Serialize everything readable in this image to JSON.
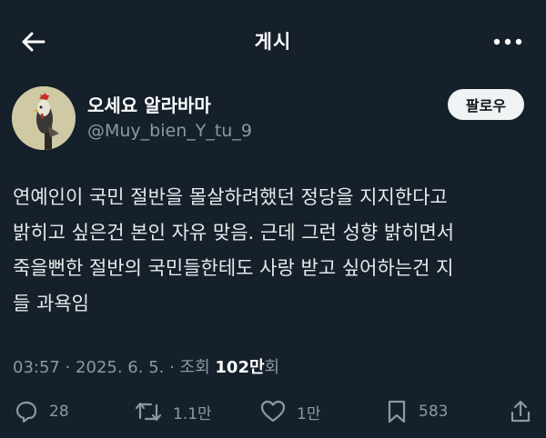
{
  "header": {
    "title": "게시",
    "back_icon": "arrow-left-icon",
    "more_icon": "more-horizontal-icon"
  },
  "author": {
    "display_name": "오세요 알라바마",
    "handle": "@Muy_bien_Y_tu_9",
    "follow_label": "팔로우"
  },
  "tweet": {
    "lines": [
      "연예인이 국민 절반을 몰살하려했던 정당을 지지한다고",
      "밝히고 싶은건 본인 자유 맞음. 근데 그런 성향 밝히면서",
      "죽을뻔한 절반의 국민들한테도 사랑 받고 싶어하는건 지",
      "들 과욕임"
    ]
  },
  "meta": {
    "time": "03:57",
    "separator1": " · ",
    "date": "2025. 6. 5.",
    "separator2": " · ",
    "views_label": "조회 ",
    "views_count": "102만",
    "views_suffix": "회"
  },
  "actions": {
    "reply_count": "28",
    "retweet_count": "1.1만",
    "like_count": "1만",
    "bookmark_count": "583"
  },
  "colors": {
    "background": "#15202b",
    "text": "#e7e9ea",
    "muted": "#8b98a5",
    "follow_bg": "#eff3f4"
  }
}
